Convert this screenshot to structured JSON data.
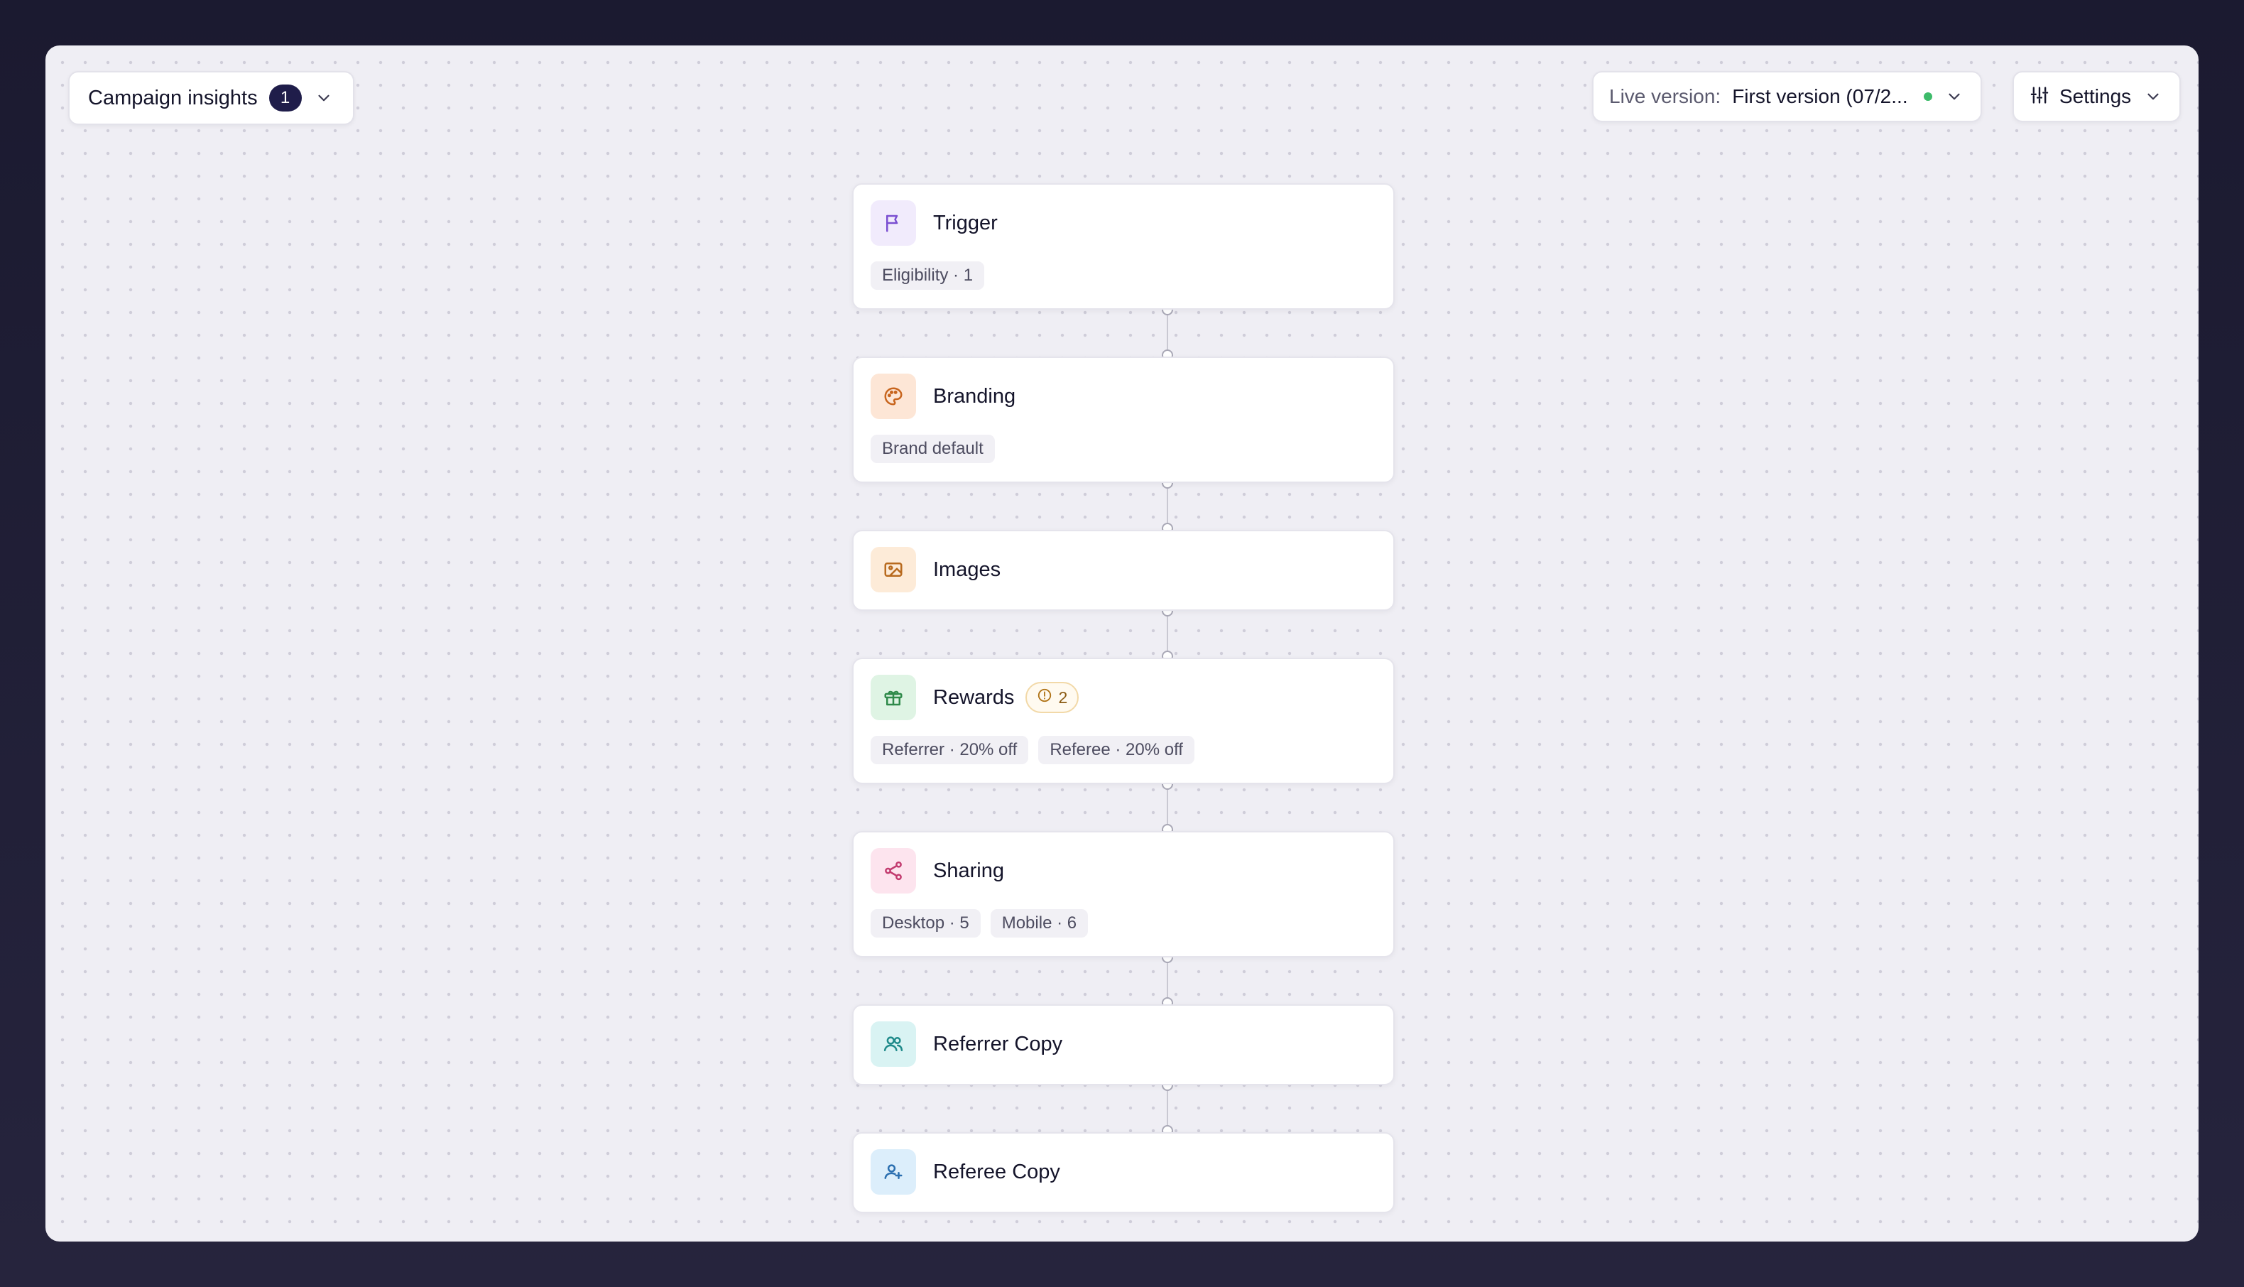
{
  "toolbar": {
    "insights_label": "Campaign insights",
    "insights_count": "1",
    "live_version_label": "Live version:",
    "live_version_value": "First version (07/2...",
    "settings_label": "Settings"
  },
  "colors": {
    "trigger": "#f1ebfc",
    "branding": "#fde6d6",
    "images": "#fdebd8",
    "rewards": "#dff4e4",
    "sharing": "#fde4ee",
    "referrer_copy": "#d9f3f3",
    "referee_copy": "#dceefb",
    "live_dot": "#3dbb6a"
  },
  "flow": {
    "trigger": {
      "title": "Trigger",
      "icon": "flag-icon",
      "tags": [
        "Eligibility · 1"
      ]
    },
    "branding": {
      "title": "Branding",
      "icon": "palette-icon",
      "tags": [
        "Brand default"
      ]
    },
    "images": {
      "title": "Images",
      "icon": "image-icon",
      "tags": []
    },
    "rewards": {
      "title": "Rewards",
      "icon": "gift-icon",
      "warning_count": "2",
      "tags": [
        "Referrer · 20% off",
        "Referee · 20% off"
      ]
    },
    "sharing": {
      "title": "Sharing",
      "icon": "share-icon",
      "tags": [
        "Desktop · 5",
        "Mobile · 6"
      ]
    },
    "referrer_copy": {
      "title": "Referrer Copy",
      "icon": "users-icon",
      "tags": []
    },
    "referee_copy": {
      "title": "Referee Copy",
      "icon": "user-plus-icon",
      "tags": []
    }
  }
}
